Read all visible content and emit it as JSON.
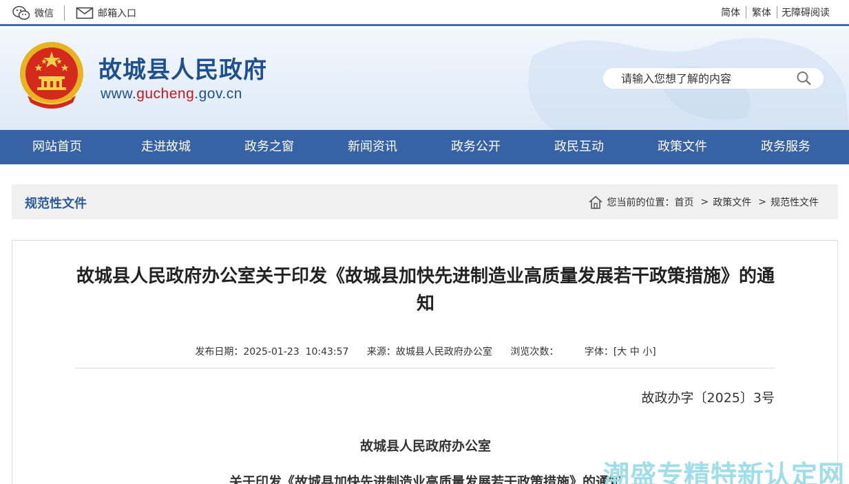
{
  "topbar": {
    "wechat_label": "微信",
    "mail_label": "邮箱入口",
    "lang_simplified": "简体",
    "lang_traditional": "繁体",
    "accessibility": "无障碍阅读"
  },
  "header": {
    "site_title": "故城县人民政府",
    "url_prefix": "www.",
    "url_highlight": "gucheng",
    "url_suffix": ".gov.cn",
    "search_placeholder": "请输入您想了解的内容"
  },
  "nav": {
    "items": [
      "网站首页",
      "走进故城",
      "政务之窗",
      "新闻资讯",
      "政务公开",
      "政民互动",
      "政策文件",
      "政务服务"
    ]
  },
  "breadcrumb": {
    "section_title": "规范性文件",
    "location_label": "您当前的位置：",
    "path": [
      "首页",
      "政策文件",
      "规范性文件"
    ]
  },
  "article": {
    "title": "故城县人民政府办公室关于印发《故城县加快先进制造业高质量发展若干政策措施》的通知",
    "publish_label": "发布日期：",
    "publish_date": "2025-01-23  10:43:57",
    "source_label": "来源：",
    "source": "故城县人民政府办公室",
    "views_label": "浏览次数：",
    "views": "",
    "font_label": "字体：",
    "font_bracket_open": "[",
    "font_large": "大",
    "font_medium": "中",
    "font_small": "小",
    "font_bracket_close": "]",
    "doc_number": "故政办字〔2025〕3号",
    "issuer": "故城县人民政府办公室",
    "subtitle_partial": "关于印发《故城县加快先进制造业高质量发展若干政策措施》的通知"
  },
  "watermark": "潮盛专精特新认定网",
  "colors": {
    "brand_blue": "#3762a3",
    "title_blue": "#1f4f8f",
    "url_red": "#c8161d"
  }
}
